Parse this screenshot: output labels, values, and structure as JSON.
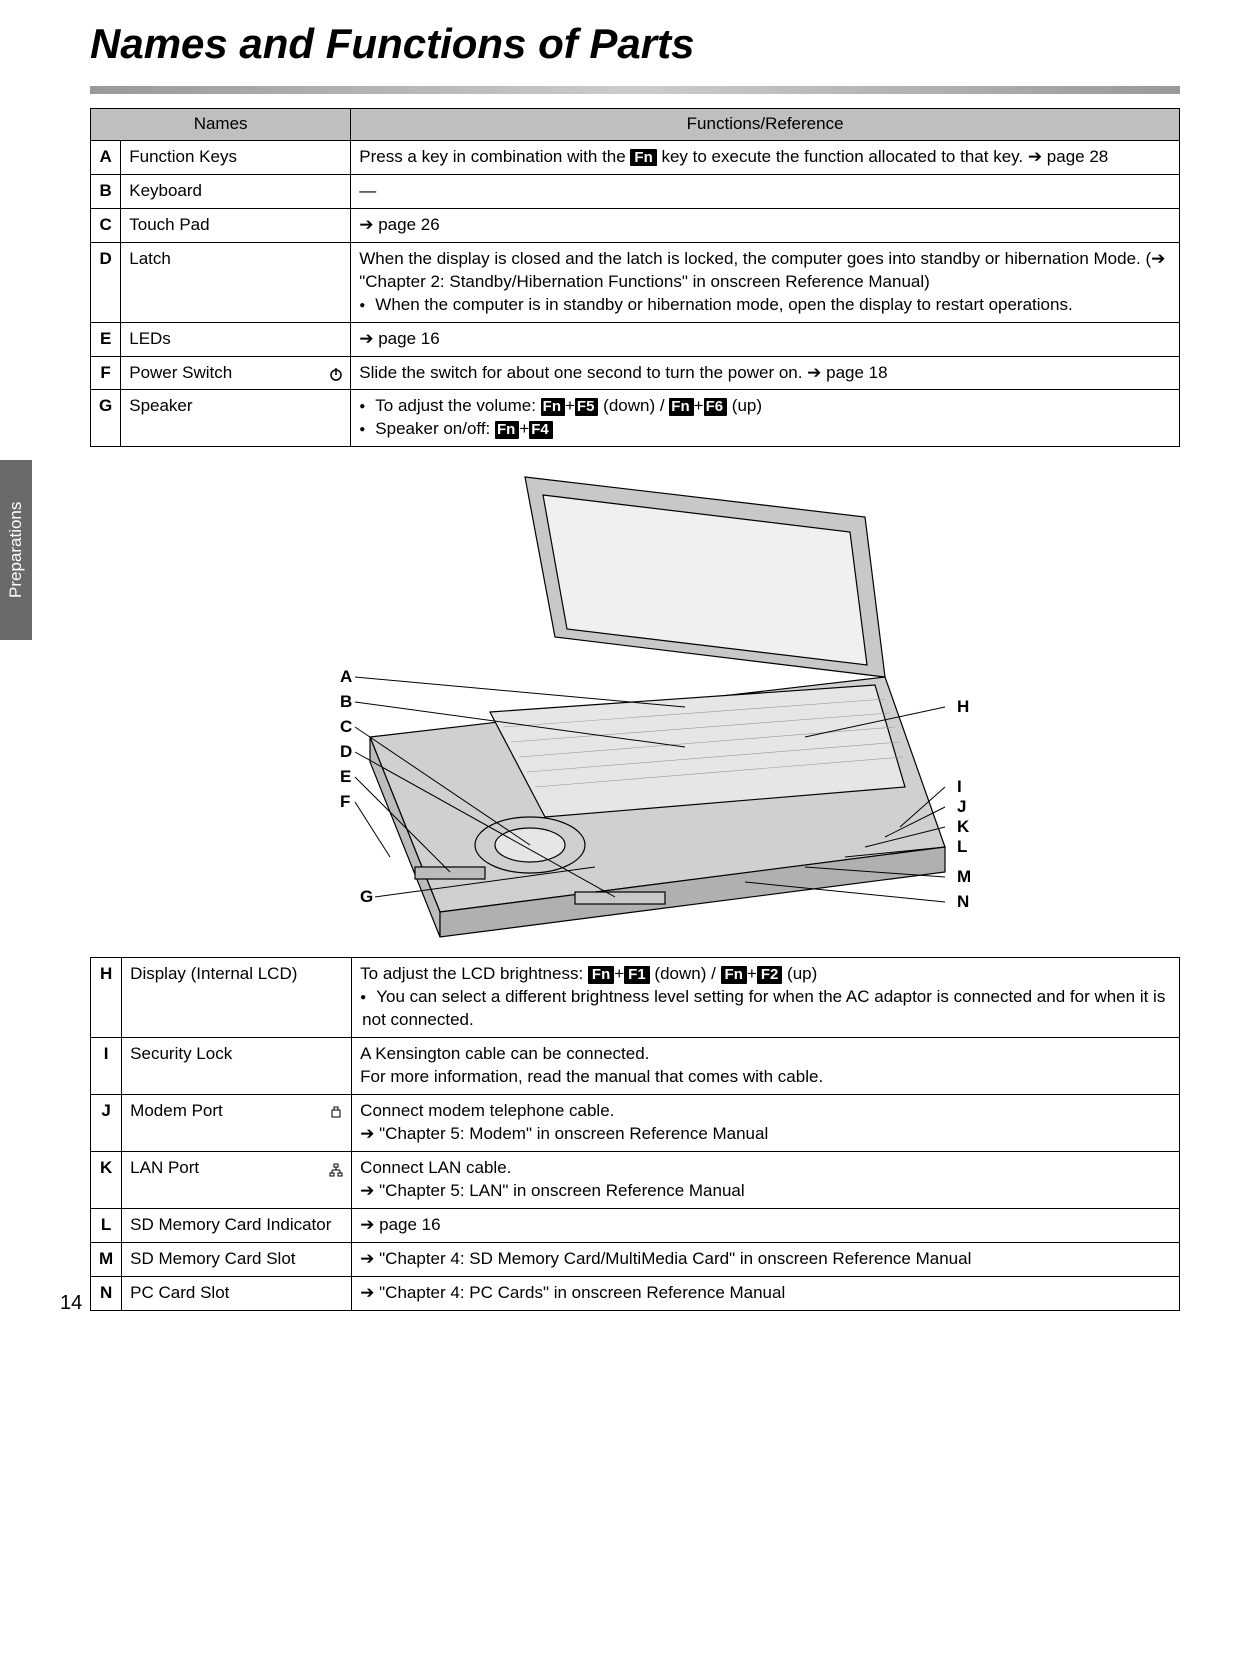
{
  "page_title": "Names and Functions of Parts",
  "sidebar_label": "Preparations",
  "page_number": "14",
  "table_headers": {
    "names": "Names",
    "functions": "Functions/Reference"
  },
  "rows1": [
    {
      "letter": "A",
      "name": "Function Keys",
      "func": "Press a key in combination with the [Fn] key to execute the function allocated to that key. ➔ page 28"
    },
    {
      "letter": "B",
      "name": "Keyboard",
      "func": "—"
    },
    {
      "letter": "C",
      "name": "Touch Pad",
      "func": "➔ page 26"
    },
    {
      "letter": "D",
      "name": "Latch",
      "func": "When the display is closed and the latch is locked, the computer goes into standby or hibernation Mode. (➔ \"Chapter 2: Standby/Hibernation Functions\" in onscreen Reference Manual)",
      "bullets": [
        "When the computer is in standby or hibernation mode, open the display to restart operations."
      ]
    },
    {
      "letter": "E",
      "name": "LEDs",
      "func": "➔ page 16"
    },
    {
      "letter": "F",
      "name": "Power Switch",
      "icon": "power",
      "func": "Slide the switch for about one second to turn the power on. ➔ page 18"
    },
    {
      "letter": "G",
      "name": "Speaker",
      "bullets": [
        "To adjust the volume: [Fn]+[F5] (down) / [Fn]+[F6] (up)",
        "Speaker on/off: [Fn]+[F4]"
      ]
    }
  ],
  "rows2": [
    {
      "letter": "H",
      "name": "Display (Internal LCD)",
      "func": "To adjust the LCD brightness: [Fn]+[F1] (down) / [Fn]+[F2] (up)",
      "bullets": [
        "You can select a different brightness level setting for when the AC adaptor is connected and for when it is not connected."
      ]
    },
    {
      "letter": "I",
      "name": "Security Lock",
      "func": "A Kensington cable can be connected.\nFor more information, read the manual that comes with cable."
    },
    {
      "letter": "J",
      "name": "Modem Port",
      "icon": "modem",
      "func": "Connect modem telephone cable.\n➔ \"Chapter 5: Modem\" in onscreen Reference Manual"
    },
    {
      "letter": "K",
      "name": "LAN Port",
      "icon": "lan",
      "func": "Connect LAN cable.\n➔ \"Chapter 5: LAN\" in onscreen Reference Manual"
    },
    {
      "letter": "L",
      "name": "SD Memory Card Indicator",
      "func": "➔ page 16"
    },
    {
      "letter": "M",
      "name": "SD Memory Card Slot",
      "func": "➔ \"Chapter 4: SD Memory Card/MultiMedia Card\" in onscreen Reference Manual"
    },
    {
      "letter": "N",
      "name": "PC Card Slot",
      "func": "➔ \"Chapter 4: PC Cards\" in onscreen Reference Manual"
    }
  ],
  "diagram_labels_left": [
    "A",
    "B",
    "C",
    "D",
    "E",
    "F",
    "G"
  ],
  "diagram_labels_right": [
    "H",
    "I",
    "J",
    "K",
    "L",
    "M",
    "N"
  ]
}
